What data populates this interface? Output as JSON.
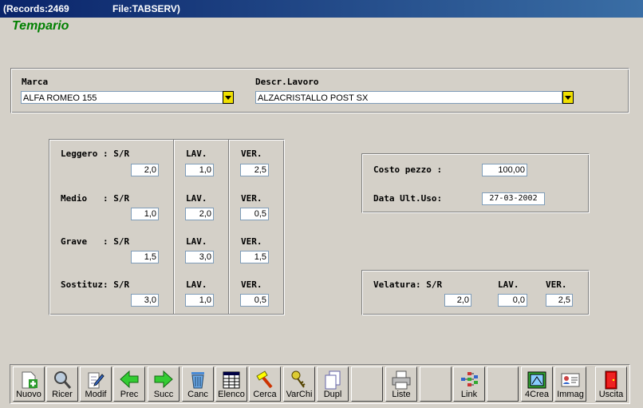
{
  "window": {
    "records": "(Records:2469",
    "file": "File:TABSERV)"
  },
  "app_title": "Tempario",
  "marca": {
    "label": "Marca",
    "value": "ALFA ROMEO 155"
  },
  "descr": {
    "label": "Descr.Lavoro",
    "value": "ALZACRISTALLO POST SX"
  },
  "grid": {
    "rows": [
      {
        "label": "Leggero : S/R",
        "sr": "2,0",
        "lav_label": "LAV.",
        "lav": "1,0",
        "ver_label": "VER.",
        "ver": "2,5"
      },
      {
        "label": "Medio   : S/R",
        "sr": "1,0",
        "lav_label": "LAV.",
        "lav": "2,0",
        "ver_label": "VER.",
        "ver": "0,5"
      },
      {
        "label": "Grave   : S/R",
        "sr": "1,5",
        "lav_label": "LAV.",
        "lav": "3,0",
        "ver_label": "VER.",
        "ver": "1,5"
      },
      {
        "label": "Sostituz: S/R",
        "sr": "3,0",
        "lav_label": "LAV.",
        "lav": "1,0",
        "ver_label": "VER.",
        "ver": "0,5"
      }
    ]
  },
  "costo": {
    "label": "Costo pezzo :",
    "value": "100,00"
  },
  "data_uso": {
    "label": "Data Ult.Uso:",
    "value": "27-03-2002"
  },
  "velatura": {
    "label": "Velatura: S/R",
    "sr": "2,0",
    "lav_label": "LAV.",
    "lav": "0,0",
    "ver_label": "VER.",
    "ver": "2,5"
  },
  "toolbar": {
    "nuovo": "Nuovo",
    "ricer": "Ricer",
    "modif": "Modif",
    "prec": "Prec",
    "succ": "Succ",
    "canc": "Canc",
    "elenco": "Elenco",
    "cerca": "Cerca",
    "varchi": "VarChi",
    "dupl": "Dupl",
    "liste": "Liste",
    "link": "Link",
    "crea4": "4Crea",
    "immag": "Immag",
    "uscita": "Uscita"
  },
  "colors": {
    "title_green": "#008000",
    "titlebar": "#0a246a",
    "combo_button": "#f0e000"
  }
}
